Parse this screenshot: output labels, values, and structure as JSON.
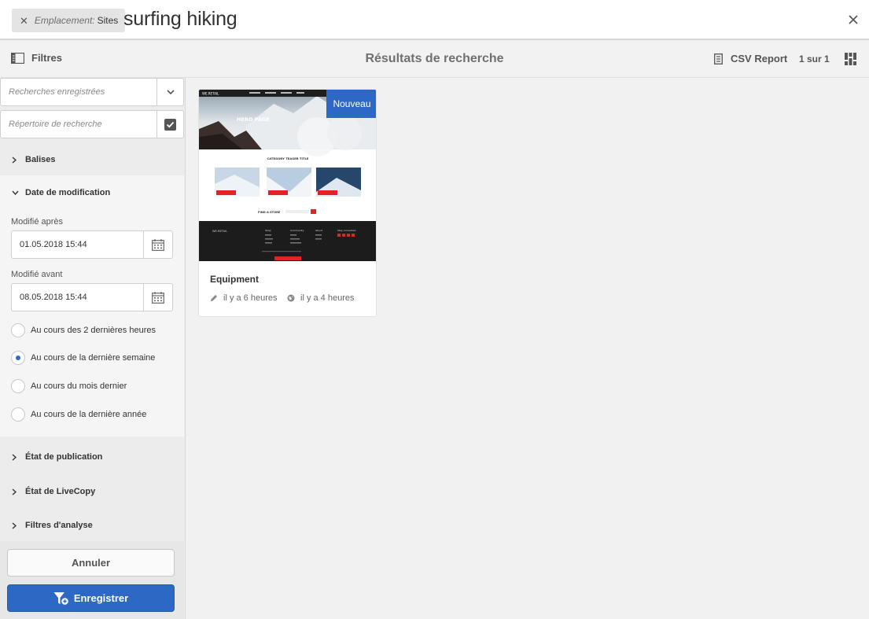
{
  "search": {
    "tag_key": "Emplacement:",
    "tag_value": "Sites",
    "query": "surfing hiking"
  },
  "actionbar": {
    "filters_label": "Filtres",
    "title": "Résultats de recherche",
    "csv_label": "CSV Report",
    "pager": "1 sur 1"
  },
  "rail": {
    "saved_searches_placeholder": "Recherches enregistrées",
    "search_directory_placeholder": "Répertoire de recherche",
    "sections": {
      "tags": "Balises",
      "modified_date": "Date de modification",
      "publish_state": "État de publication",
      "livecopy_state": "État de LiveCopy",
      "analytics_filters": "Filtres d'analyse"
    },
    "modified_after_label": "Modifié après",
    "modified_after_value": "01.05.2018 15:44",
    "modified_before_label": "Modifié avant",
    "modified_before_value": "08.05.2018 15:44",
    "radio_options": [
      "Au cours des 2 dernières heures",
      "Au cours de la dernière semaine",
      "Au cours du mois dernier",
      "Au cours de la dernière année"
    ],
    "selected_radio": 1,
    "cancel_label": "Annuler",
    "save_label": "Enregistrer"
  },
  "card": {
    "badge": "Nouveau",
    "title": "Equipment",
    "modified": "il y a 6 heures",
    "published": "il y a 4 heures",
    "thumb": {
      "logo": "WE.RETAIL",
      "hero": "HERO PAGE",
      "teaser": "CATEGORY TEASER TITLE",
      "store": "FIND A STORE",
      "footer_cols": [
        "Shop",
        "Community",
        "About",
        "Stay connected"
      ]
    }
  },
  "colors": {
    "accent": "#2e68c5",
    "retail_red": "#e32222"
  }
}
